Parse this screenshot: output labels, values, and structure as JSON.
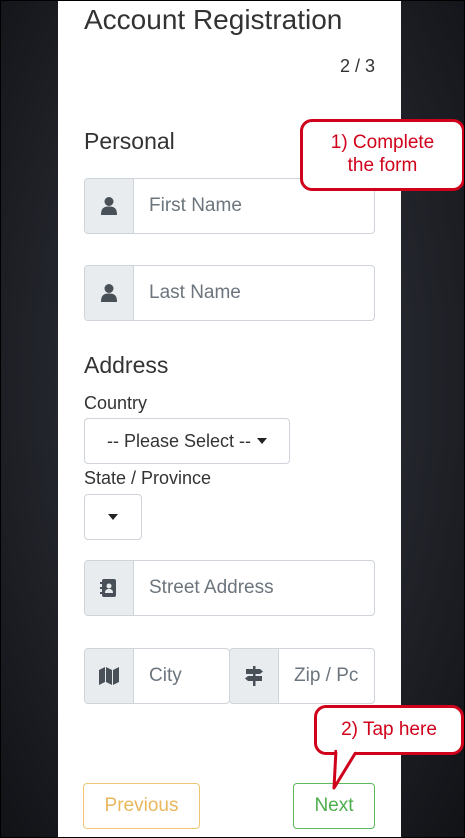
{
  "form": {
    "title": "Account Registration",
    "step": "2 / 3",
    "personal_heading": "Personal",
    "first_name_placeholder": "First Name",
    "last_name_placeholder": "Last Name",
    "address_heading": "Address",
    "country_label": "Country",
    "country_value": "-- Please Select --",
    "state_label": "State / Province",
    "street_placeholder": "Street Address",
    "city_placeholder": "City",
    "zip_placeholder": "Zip / Pc"
  },
  "buttons": {
    "previous": "Previous",
    "next": "Next"
  },
  "annotations": {
    "callout1_line1": "1) Complete",
    "callout1_line2": "the form",
    "callout2": "2) Tap here"
  },
  "colors": {
    "annotation": "#d0021b",
    "previous_button": "#f0ad4e",
    "next_button": "#5cb85c"
  },
  "icons": {
    "first_name": "user-icon",
    "last_name": "user-icon",
    "street": "address-book-icon",
    "city": "map-icon",
    "zip": "signpost-icon"
  }
}
